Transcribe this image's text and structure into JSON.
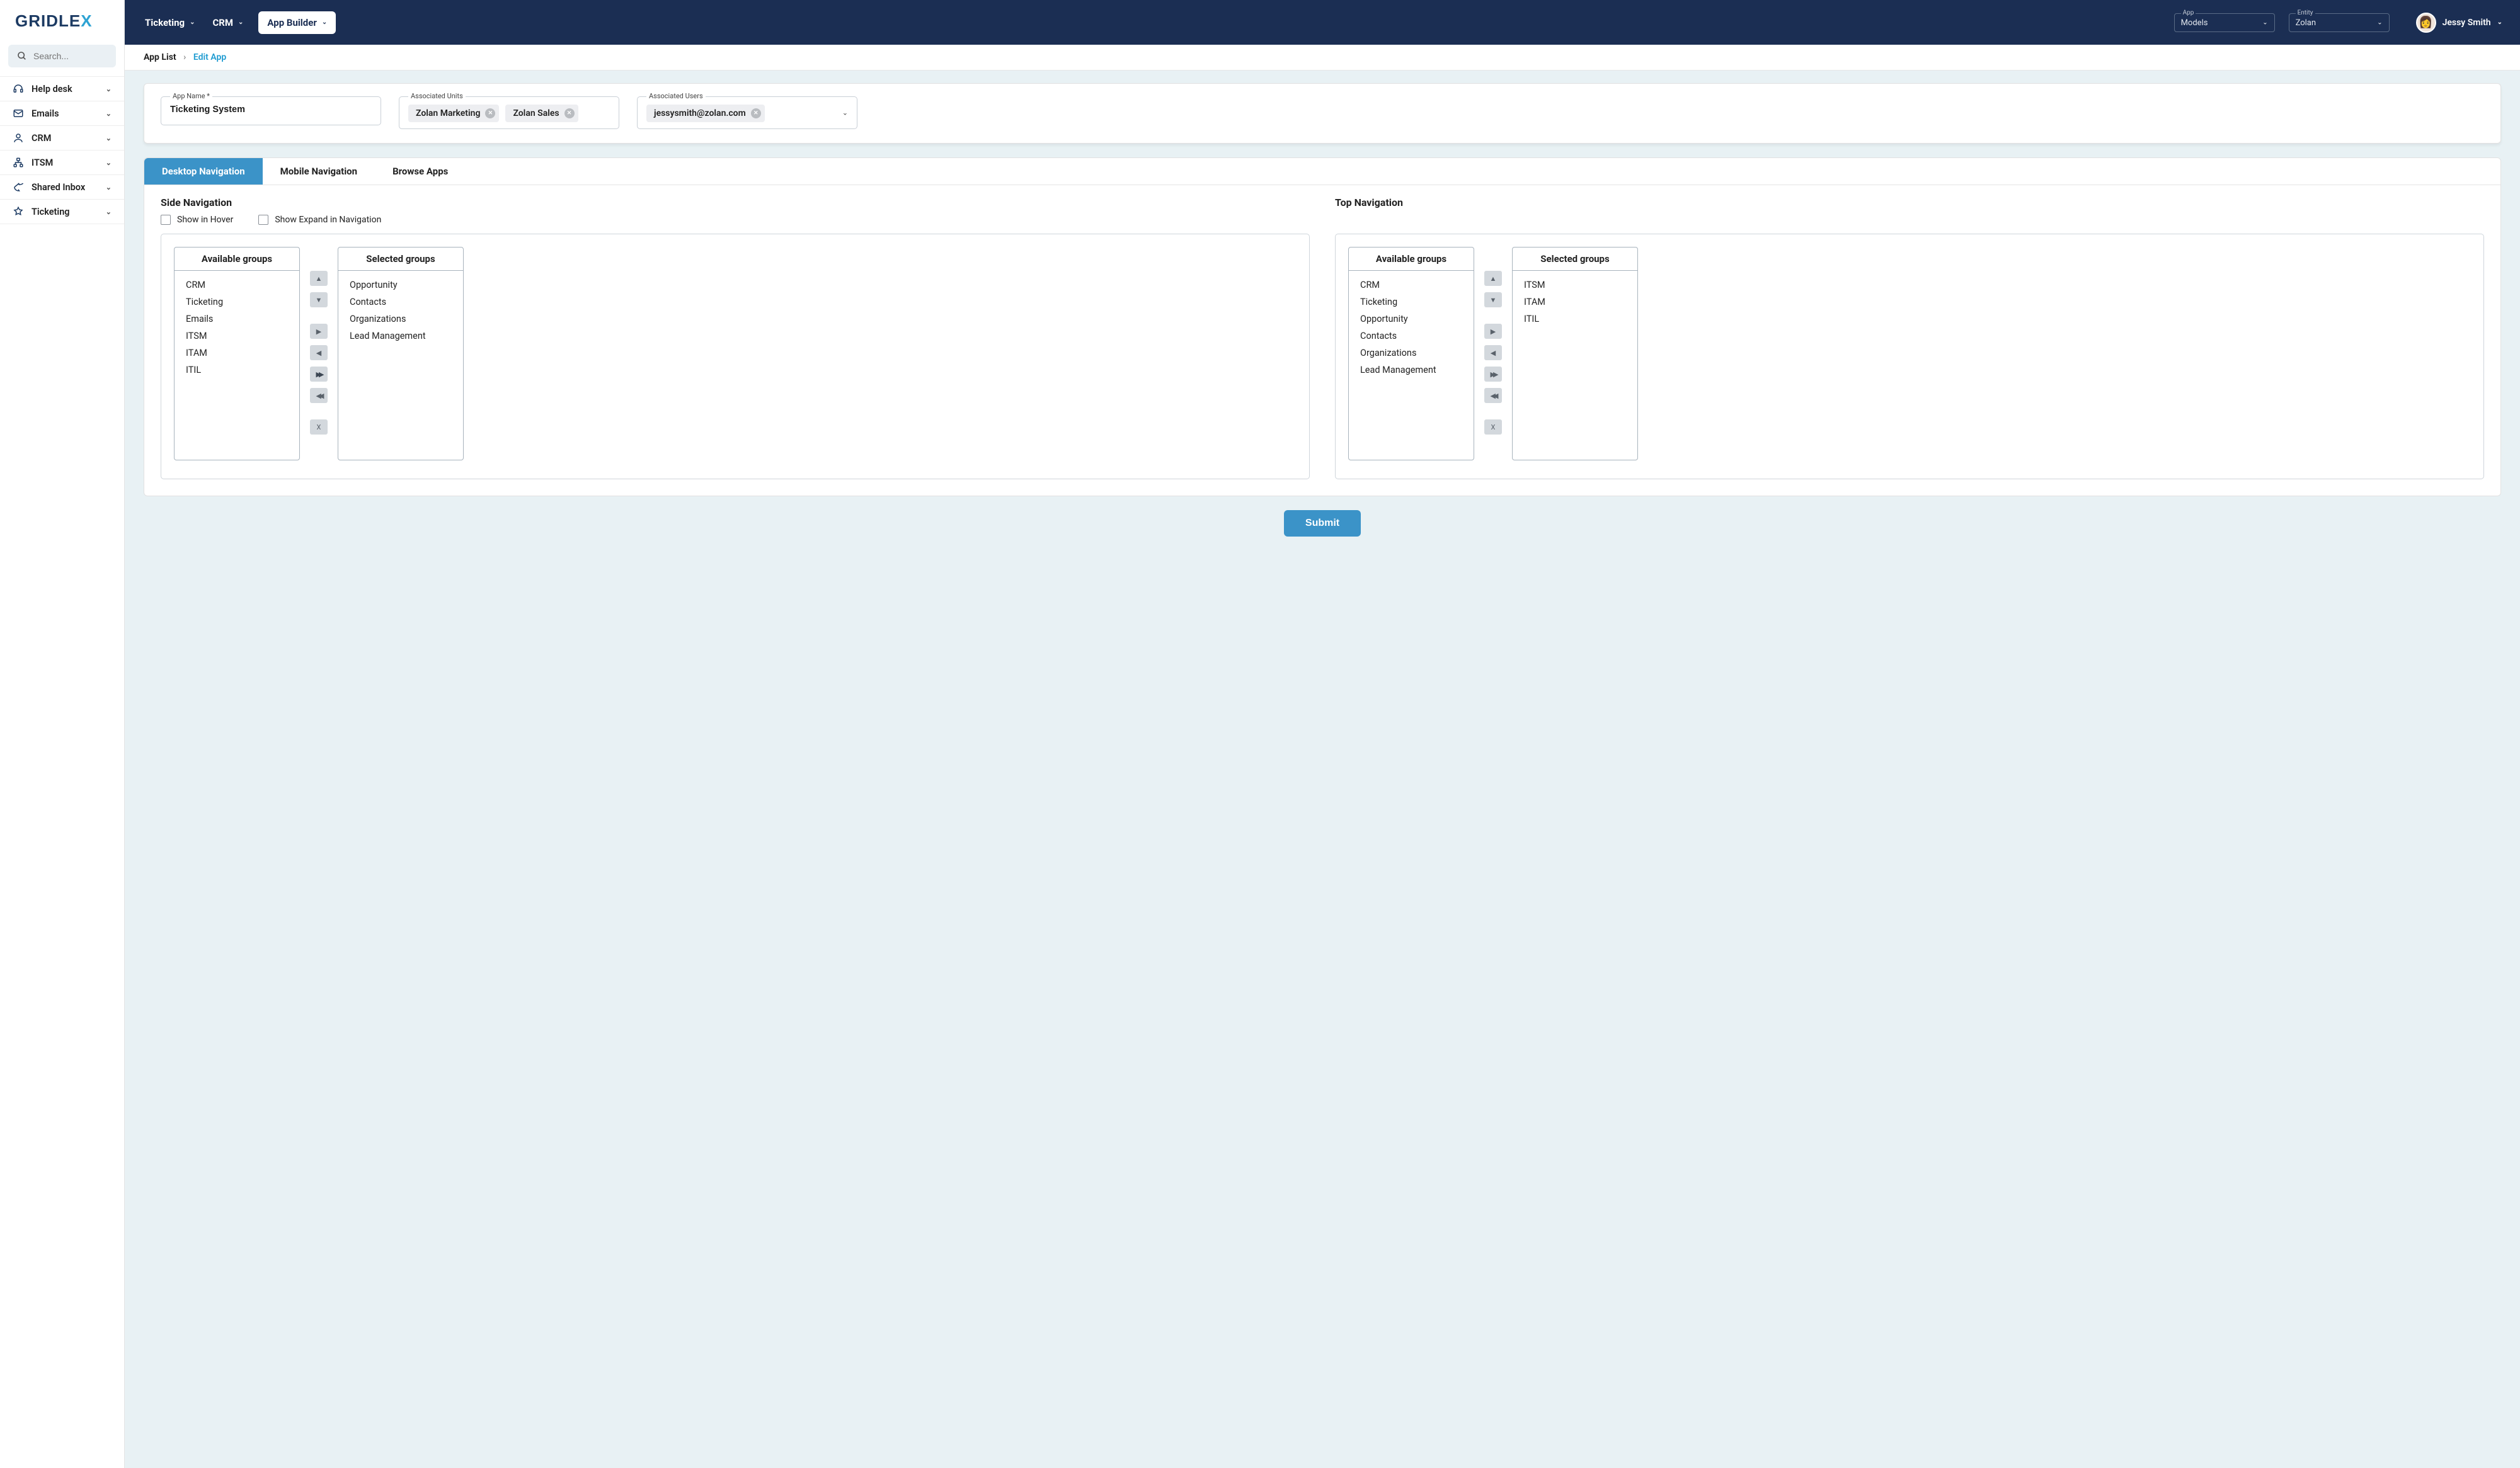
{
  "logo": {
    "part1": "GRIDLE",
    "part2": "X"
  },
  "search": {
    "placeholder": "Search..."
  },
  "sidebar": {
    "items": [
      {
        "label": "Help desk",
        "icon": "headset"
      },
      {
        "label": "Emails",
        "icon": "mail"
      },
      {
        "label": "CRM",
        "icon": "user"
      },
      {
        "label": "ITSM",
        "icon": "sitemap"
      },
      {
        "label": "Shared Inbox",
        "icon": "share"
      },
      {
        "label": "Ticketing",
        "icon": "ticket"
      }
    ]
  },
  "topbar": {
    "menu": [
      {
        "label": "Ticketing",
        "active": false
      },
      {
        "label": "CRM",
        "active": false
      },
      {
        "label": "App Builder",
        "active": true
      }
    ],
    "app_select": {
      "label": "App",
      "value": "Models"
    },
    "entity_select": {
      "label": "Entity",
      "value": "Zolan"
    },
    "user": {
      "name": "Jessy Smith"
    }
  },
  "breadcrumb": {
    "root": "App List",
    "current": "Edit App"
  },
  "form": {
    "app_name": {
      "label": "App Name *",
      "value": "Ticketing System"
    },
    "units": {
      "label": "Associated Units",
      "chips": [
        "Zolan Marketing",
        "Zolan Sales"
      ]
    },
    "users": {
      "label": "Associated Users",
      "chips": [
        "jessysmith@zolan.com"
      ]
    }
  },
  "tabs": {
    "items": [
      "Desktop Navigation",
      "Mobile Navigation",
      "Browse Apps"
    ],
    "active_index": 0
  },
  "side_nav_section": {
    "title": "Side Navigation",
    "check1": "Show in Hover",
    "check2": "Show Expand in Navigation",
    "available_title": "Available groups",
    "selected_title": "Selected groups",
    "available": [
      "CRM",
      "Ticketing",
      "Emails",
      "ITSM",
      "ITAM",
      "ITIL"
    ],
    "selected": [
      "Opportunity",
      "Contacts",
      "Organizations",
      "Lead Management"
    ]
  },
  "top_nav_section": {
    "title": "Top Navigation",
    "available_title": "Available groups",
    "selected_title": "Selected groups",
    "available": [
      "CRM",
      "Ticketing",
      "Opportunity",
      "Contacts",
      "Organizations",
      "Lead Management"
    ],
    "selected": [
      "ITSM",
      "ITAM",
      "ITIL"
    ]
  },
  "ctrl_glyphs": {
    "up": "▲",
    "down": "▼",
    "right": "▶",
    "left": "◀",
    "allright": "⏩",
    "allleft": "⏪",
    "clear": "X"
  },
  "submit_label": "Submit"
}
